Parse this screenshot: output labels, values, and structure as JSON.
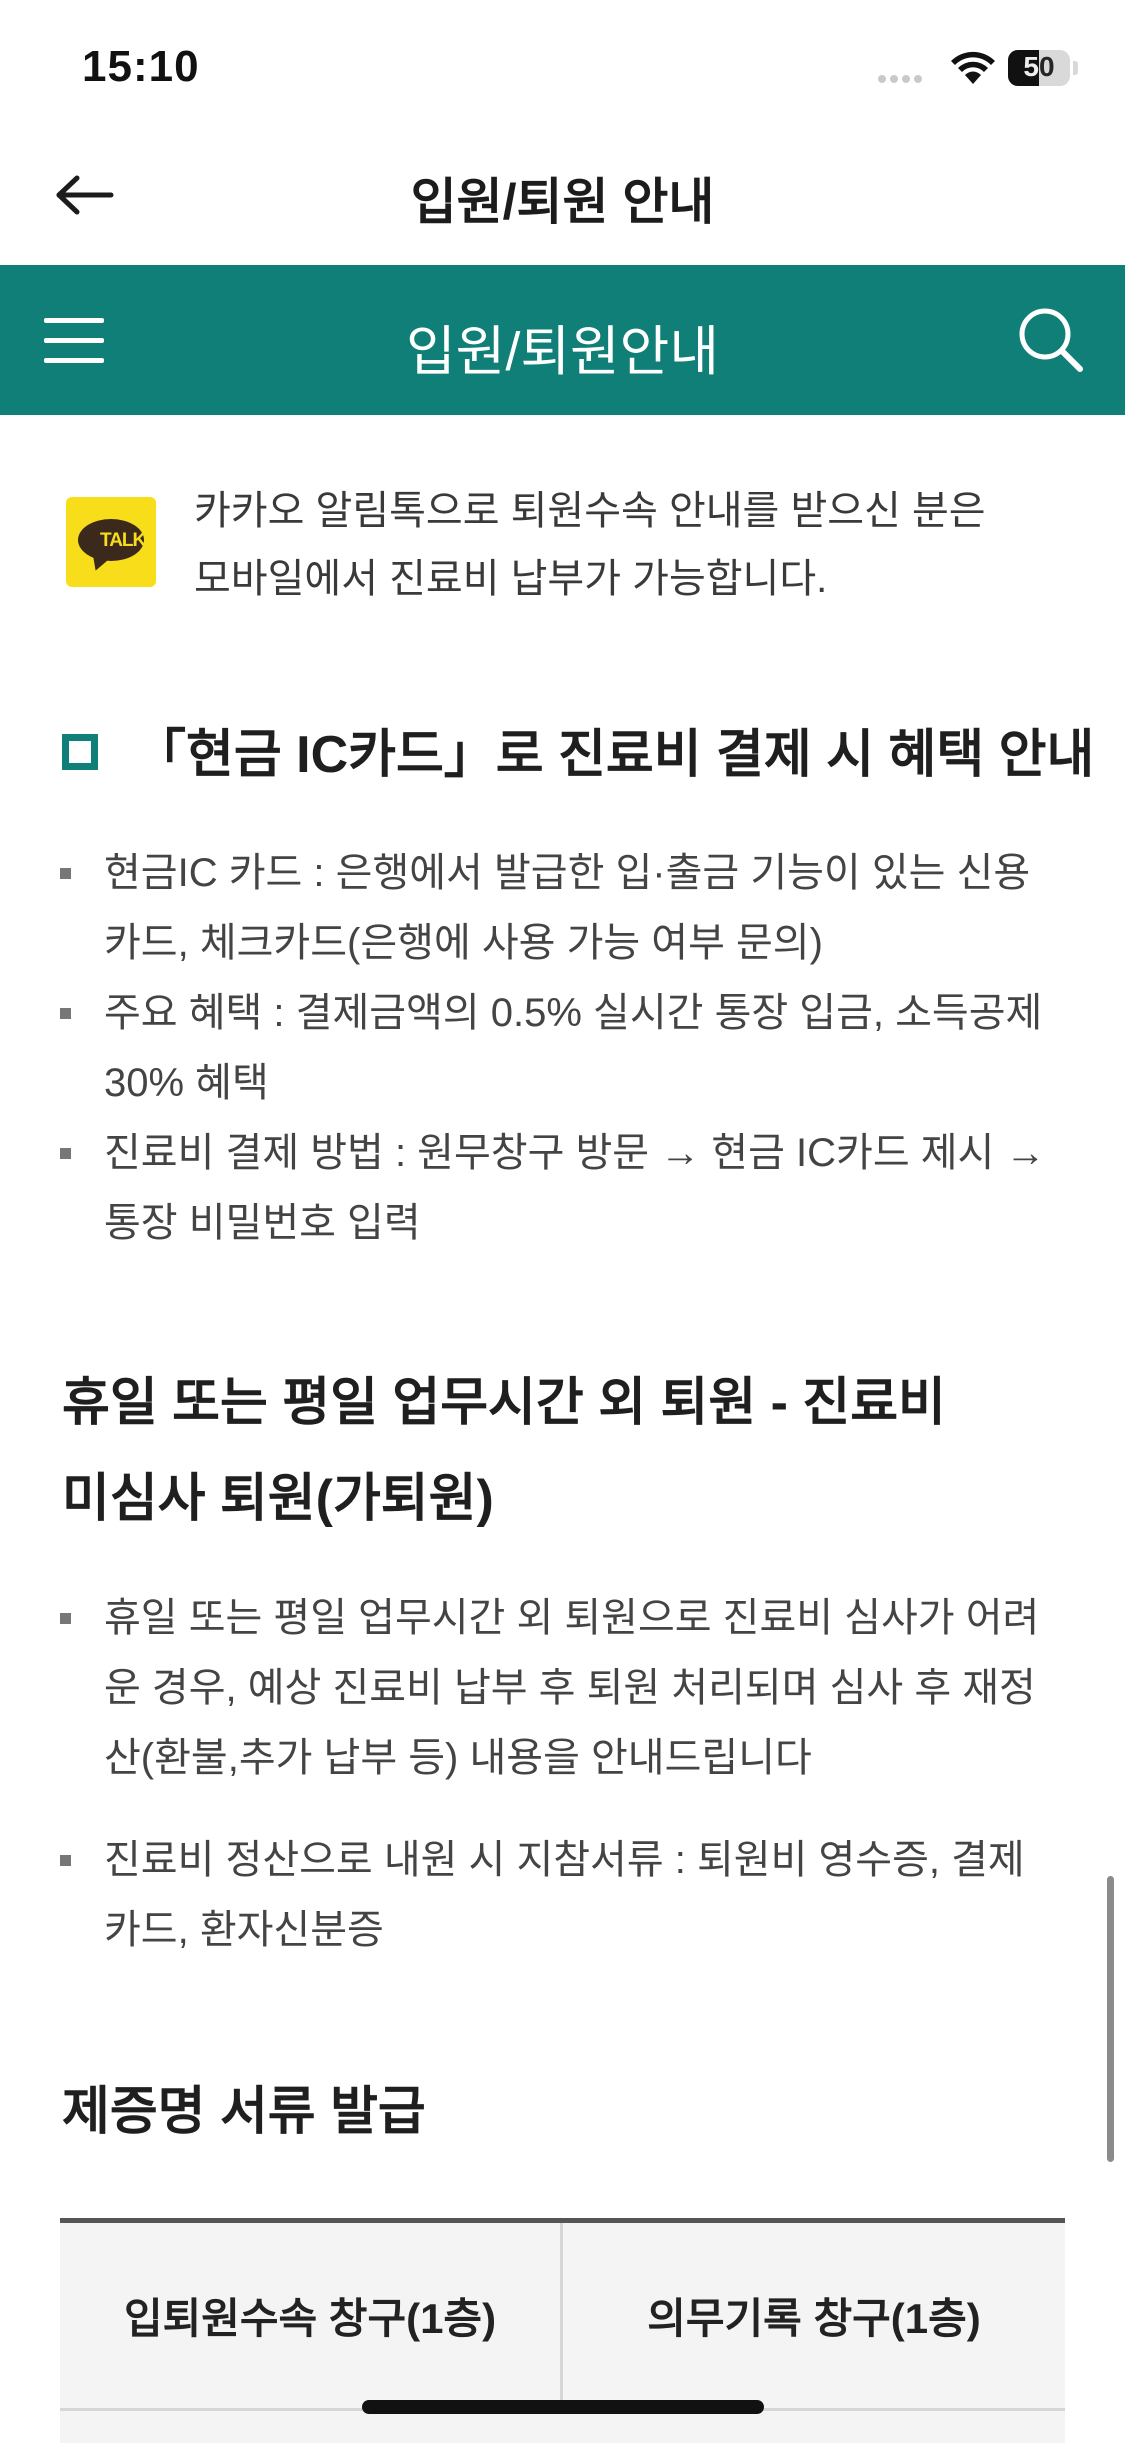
{
  "status": {
    "time": "15:10",
    "battery": "50"
  },
  "header": {
    "title": "입원/퇴원 안내"
  },
  "greenbar": {
    "title": "입원/퇴원안내"
  },
  "kakao": {
    "badge": "TALK",
    "lines": [
      "카카오 알림톡으로 퇴원수속 안내를 받으신 분은",
      "모바일에서 진료비 납부가 가능합니다."
    ]
  },
  "cash_ic": {
    "heading": "「현금 IC카드」로 진료비 결제 시 혜택 안내",
    "items": [
      [
        "현금IC 카드 : 은행에서 발급한 입·출금 기능이 있는 신용",
        "카드, 체크카드(은행에 사용 가능 여부 문의)"
      ],
      [
        "주요 혜택 : 결제금액의 0.5% 실시간 통장 입금, 소득공제",
        "30% 혜택"
      ],
      [
        "진료비 결제 방법 : 원무창구 방문 → 현금 IC카드 제시 →",
        "통장 비밀번호 입력"
      ]
    ]
  },
  "holiday": {
    "heading": [
      "휴일 또는 평일 업무시간 외 퇴원 - 진료비",
      "미심사 퇴원(가퇴원)"
    ],
    "items": [
      [
        "휴일 또는 평일 업무시간 외 퇴원으로 진료비 심사가 어려",
        "운 경우, 예상 진료비 납부 후 퇴원 처리되며 심사 후 재정",
        "산(환불,추가 납부 등) 내용을 안내드립니다"
      ],
      [
        "진료비 정산으로 내원 시 지참서류 : 퇴원비 영수증, 결제",
        "카드, 환자신분증"
      ]
    ]
  },
  "certificate": {
    "heading": "제증명 서류 발급",
    "columns": [
      "입퇴원수속 창구(1층)",
      "의무기록 창구(1층)"
    ]
  }
}
